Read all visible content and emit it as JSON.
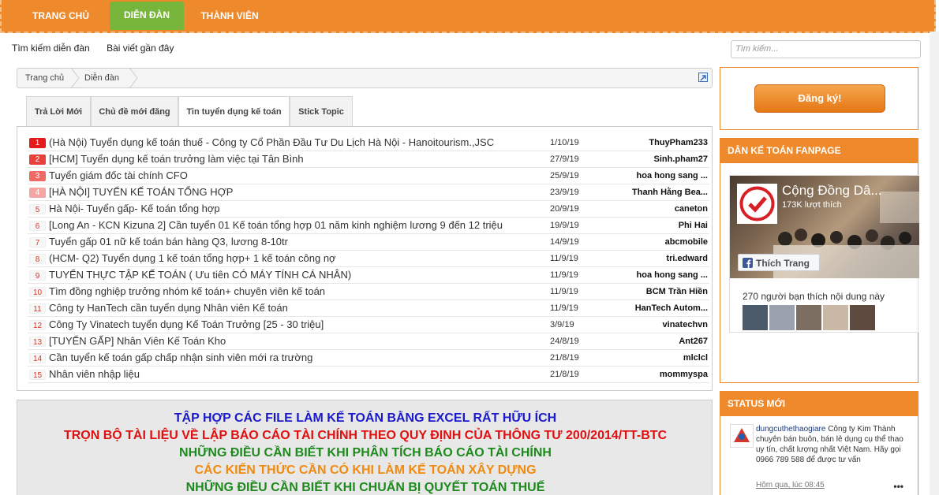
{
  "nav": {
    "tabs": [
      {
        "label": "TRANG CHỦ",
        "active": false
      },
      {
        "label": "DIỄN ĐÀN",
        "active": true
      },
      {
        "label": "THÀNH VIÊN",
        "active": false
      }
    ],
    "accent": "#ee8a2b",
    "active_color": "#78b53b"
  },
  "subnav": {
    "search_forum": "Tìm kiếm diễn đàn",
    "recent_posts": "Bài viết gần đây"
  },
  "search": {
    "placeholder": "Tìm kiếm..."
  },
  "breadcrumb": {
    "items": [
      "Trang chủ",
      "Diễn đàn"
    ]
  },
  "forum_tabs": [
    {
      "label": "Trả Lời Mới",
      "active": false
    },
    {
      "label": "Chủ đề mới đăng",
      "active": false
    },
    {
      "label": "Tin tuyển dụng kế toán",
      "active": true
    },
    {
      "label": "Stick Topic",
      "active": false
    }
  ],
  "threads": [
    {
      "n": "1",
      "title": "(Hà Nội) Tuyển dụng kế toán thuế - Công ty Cổ Phần Đầu Tư Du Lịch Hà Nội - Hanoitourism.,JSC",
      "date": "1/10/19",
      "user": "ThuyPham233"
    },
    {
      "n": "2",
      "title": "[HCM] Tuyển dụng kế toán trưởng làm việc tại Tân Bình",
      "date": "27/9/19",
      "user": "Sinh.pham27"
    },
    {
      "n": "3",
      "title": "Tuyển giám đốc tài chính CFO",
      "date": "25/9/19",
      "user": "hoa hong sang ..."
    },
    {
      "n": "4",
      "title": "[HÀ NỘI] TUYỂN KẾ TOÁN TỔNG HỢP",
      "date": "23/9/19",
      "user": "Thanh Hằng Bea..."
    },
    {
      "n": "5",
      "title": "Hà Nội- Tuyển gấp- Kế toán tổng hợp",
      "date": "20/9/19",
      "user": "caneton"
    },
    {
      "n": "6",
      "title": "[Long An - KCN Kizuna 2] Cần tuyển 01 Kế toán tổng hợp 01 năm kinh nghiệm lương 9 đến 12 triệu",
      "date": "19/9/19",
      "user": "Phi Hai"
    },
    {
      "n": "7",
      "title": "Tuyển gấp 01 nữ kế toán bán hàng Q3, lương 8-10tr",
      "date": "14/9/19",
      "user": "abcmobile"
    },
    {
      "n": "8",
      "title": "(HCM- Q2) Tuyển dụng 1 kế toán tổng hợp+ 1 kế toán công nợ",
      "date": "11/9/19",
      "user": "tri.edward"
    },
    {
      "n": "9",
      "title": "TUYỂN THỰC TẬP KẾ TOÁN ( Ưu tiên CÓ MÁY TÍNH CÁ NHÂN)",
      "date": "11/9/19",
      "user": "hoa hong sang ..."
    },
    {
      "n": "10",
      "title": "Tìm đồng nghiệp trưởng nhóm kế toán+ chuyên viên kế toán",
      "date": "11/9/19",
      "user": "BCM Trần Hiền"
    },
    {
      "n": "11",
      "title": "Công ty HanTech cần tuyển dụng Nhân viên Kế toán",
      "date": "11/9/19",
      "user": "HanTech Autom..."
    },
    {
      "n": "12",
      "title": "Công Ty Vinatech tuyển dụng Kế Toán Trưởng [25 - 30 triệu]",
      "date": "3/9/19",
      "user": "vinatechvn"
    },
    {
      "n": "13",
      "title": "[TUYỂN GẤP] Nhân Viên Kế Toán Kho",
      "date": "24/8/19",
      "user": "Ant267"
    },
    {
      "n": "14",
      "title": "Cần tuyển kế toán gấp chấp nhận sinh viên mới ra trường",
      "date": "21/8/19",
      "user": "mlclcl"
    },
    {
      "n": "15",
      "title": "Nhân viên nhập liệu",
      "date": "21/8/19",
      "user": "mommyspa"
    }
  ],
  "rank_colors": [
    "#e31b1b",
    "#e8403b",
    "#ef6a64",
    "#f3a6a2"
  ],
  "promo": {
    "lines": [
      {
        "text": "TẬP HỢP CÁC FILE LÀM KẾ TOÁN BẰNG EXCEL RẤT HỮU ÍCH",
        "color": "#1a1acc"
      },
      {
        "text": "TRỌN BỘ TÀI LIỆU VỀ LẬP BÁO CÁO TÀI CHÍNH THEO QUY ĐỊNH CỦA THÔNG TƯ 200/2014/TT-BTC",
        "color": "#e01010"
      },
      {
        "text": "NHỮNG ĐIỀU CẦN BIẾT KHI PHÂN TÍCH BÁO CÁO TÀI CHÍNH",
        "color": "#1e8a1e"
      },
      {
        "text": "CÁC KIẾN THỨC CẦN CÓ KHI LÀM KẾ TOÁN XÂY DỰNG",
        "color": "#f08a10"
      },
      {
        "text": "NHỮNG ĐIỀU CẦN BIẾT KHI CHUẨN BỊ QUYẾT TOÁN THUẾ",
        "color": "#1e8a1e"
      }
    ]
  },
  "sidebar": {
    "register_label": "Đăng ký!",
    "fanpage_heading": "DÂN KẾ TOÁN FANPAGE",
    "fb": {
      "page_name": "Cộng Đồng Dâ...",
      "likes": "173K lượt thích",
      "like_button": "Thích Trang",
      "friends_text": "270 người bạn thích nội dung này"
    },
    "status_heading": "STATUS MỚI",
    "status": {
      "user": "dungcuthethaogiare",
      "text": "Công ty Kim Thành chuyên bán buôn, bán lẻ dụng cụ thể thao uy tín, chất lượng nhất Việt Nam. Hãy gọi 0966 789 588 để được tư vấn",
      "time": "Hôm qua, lúc 08:45",
      "more": "•••"
    }
  }
}
